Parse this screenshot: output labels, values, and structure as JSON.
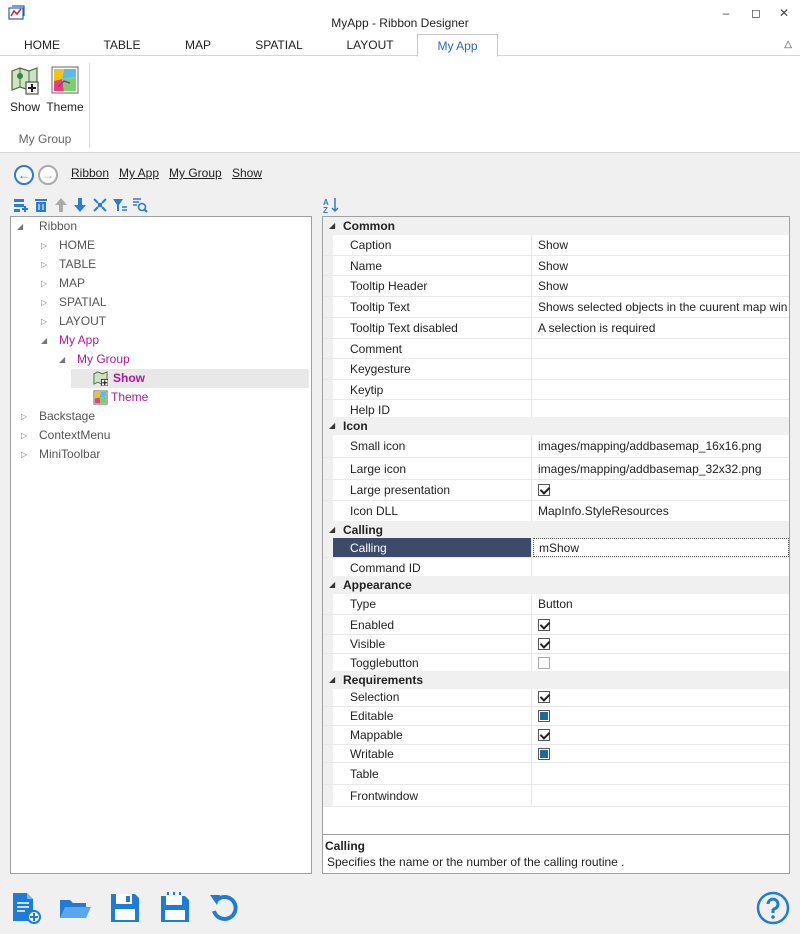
{
  "window": {
    "title": "MyApp - Ribbon Designer"
  },
  "tabs": [
    {
      "label": "HOME"
    },
    {
      "label": "TABLE"
    },
    {
      "label": "MAP"
    },
    {
      "label": "SPATIAL"
    },
    {
      "label": "LAYOUT"
    },
    {
      "label": "My App"
    }
  ],
  "ribbon": {
    "buttons": [
      {
        "label": "Show",
        "icon": "map-add-icon"
      },
      {
        "label": "Theme",
        "icon": "theme-map-icon"
      }
    ],
    "group_label": "My Group"
  },
  "breadcrumb": [
    "Ribbon",
    "My App",
    "My Group",
    "Show"
  ],
  "tree": {
    "root": "Ribbon",
    "tabs": [
      "HOME",
      "TABLE",
      "MAP",
      "SPATIAL",
      "LAYOUT"
    ],
    "app": "My App",
    "group": "My Group",
    "items": [
      {
        "label": "Show",
        "selected": true
      },
      {
        "label": "Theme",
        "selected": false
      }
    ],
    "others": [
      "Backstage",
      "ContextMenu",
      "MiniToolbar"
    ]
  },
  "props": {
    "common": {
      "label": "Common",
      "caption": {
        "name": "Caption",
        "value": "Show"
      },
      "name": {
        "name": "Name",
        "value": "Show"
      },
      "tooltip_header": {
        "name": "Tooltip Header",
        "value": "Show"
      },
      "tooltip_text": {
        "name": "Tooltip Text",
        "value": "Shows selected objects in the cuurent map win"
      },
      "tooltip_disabled": {
        "name": "Tooltip Text disabled",
        "value": "A selection is required"
      },
      "comment": {
        "name": "Comment",
        "value": ""
      },
      "keygesture": {
        "name": "Keygesture",
        "value": ""
      },
      "keytip": {
        "name": "Keytip",
        "value": ""
      },
      "help_id": {
        "name": "Help ID",
        "value": ""
      }
    },
    "icon": {
      "label": "Icon",
      "small": {
        "name": "Small icon",
        "value": "images/mapping/addbasemap_16x16.png"
      },
      "large": {
        "name": "Large icon",
        "value": "images/mapping/addbasemap_32x32.png"
      },
      "large_presentation": {
        "name": "Large presentation",
        "checked": true
      },
      "dll": {
        "name": "Icon DLL",
        "value": "MapInfo.StyleResources"
      }
    },
    "calling": {
      "label": "Calling",
      "calling": {
        "name": "Calling",
        "value": "mShow"
      },
      "command_id": {
        "name": "Command ID",
        "value": ""
      }
    },
    "appearance": {
      "label": "Appearance",
      "type": {
        "name": "Type",
        "value": "Button"
      },
      "enabled": {
        "name": "Enabled",
        "checked": true
      },
      "visible": {
        "name": "Visible",
        "checked": true
      },
      "togglebutton": {
        "name": "Togglebutton",
        "checked": false
      }
    },
    "requirements": {
      "label": "Requirements",
      "selection": {
        "name": "Selection",
        "state": "checked"
      },
      "editable": {
        "name": "Editable",
        "state": "indeterminate"
      },
      "mappable": {
        "name": "Mappable",
        "state": "checked"
      },
      "writable": {
        "name": "Writable",
        "state": "indeterminate"
      },
      "table": {
        "name": "Table",
        "value": ""
      },
      "frontwindow": {
        "name": "Frontwindow",
        "value": ""
      }
    }
  },
  "description": {
    "title": "Calling",
    "text": "Specifies the name or the number of the calling routine ."
  },
  "colors": {
    "accent": "#2b7cd3",
    "tree_highlight": "#b0179a",
    "selected_row": "#3d4b6a"
  }
}
